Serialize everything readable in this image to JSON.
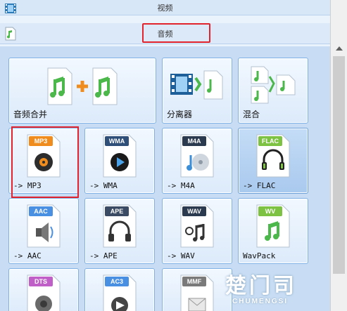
{
  "categories": {
    "video": {
      "title": "视频",
      "icon": "film-strip-icon"
    },
    "audio": {
      "title": "音频",
      "icon": "music-note-icon"
    }
  },
  "tools": [
    {
      "label": "音频合并",
      "icon": "audio-merge-icon"
    },
    {
      "label": "分离器",
      "icon": "splitter-icon"
    },
    {
      "label": "混合",
      "icon": "mix-icon"
    }
  ],
  "formats": [
    {
      "tag": "MP3",
      "label": "-> MP3",
      "icon": "mp3-file-icon",
      "tag_color": "#f08c1e"
    },
    {
      "tag": "WMA",
      "label": "-> WMA",
      "icon": "wma-file-icon",
      "tag_color": "#2f4f79"
    },
    {
      "tag": "M4A",
      "label": "-> M4A",
      "icon": "m4a-file-icon",
      "tag_color": "#2b3a4f"
    },
    {
      "tag": "FLAC",
      "label": "-> FLAC",
      "icon": "flac-file-icon",
      "tag_color": "#7dc242"
    },
    {
      "tag": "AAC",
      "label": "-> AAC",
      "icon": "aac-file-icon",
      "tag_color": "#4a90e2"
    },
    {
      "tag": "APE",
      "label": "-> APE",
      "icon": "ape-file-icon",
      "tag_color": "#3a4b63"
    },
    {
      "tag": "WAV",
      "label": "-> WAV",
      "icon": "wav-file-icon",
      "tag_color": "#2b3a4f"
    },
    {
      "tag": "WV",
      "label": "WavPack",
      "icon": "wavpack-file-icon",
      "tag_color": "#7dc242"
    },
    {
      "tag": "DTS",
      "label": "",
      "icon": "dts-file-icon",
      "tag_color": "#c05fc8"
    },
    {
      "tag": "AC3",
      "label": "",
      "icon": "ac3-file-icon",
      "tag_color": "#4a90e2"
    },
    {
      "tag": "MMF",
      "label": "",
      "icon": "mmf-file-icon",
      "tag_color": "#7a7a7a"
    }
  ],
  "watermark": {
    "big": "楚门司",
    "small": "CHUMENGSI"
  },
  "colors": {
    "highlight": "#e0232c",
    "accent": "#7fb1e6",
    "note_green": "#4cb84c",
    "plus_orange": "#f08c1e"
  }
}
